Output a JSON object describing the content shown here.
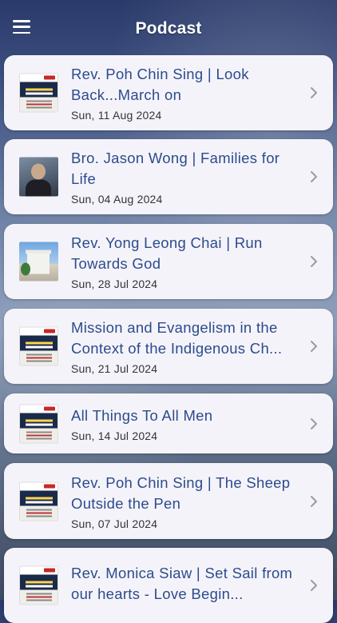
{
  "header": {
    "title": "Podcast",
    "menu_icon": "hamburger-menu-icon"
  },
  "colors": {
    "title_text": "#2b4c8c",
    "card_bg": "#f5f3fa",
    "date_text": "#333333",
    "chevron": "#9a9aa2"
  },
  "episodes": [
    {
      "title": "Rev. Poh Chin Sing | Look Back...March on",
      "date": "Sun, 11 Aug 2024",
      "thumbnail": "poster"
    },
    {
      "title": "Bro. Jason Wong | Families for Life",
      "date": "Sun, 04 Aug 2024",
      "thumbnail": "portrait"
    },
    {
      "title": "Rev. Yong Leong Chai | Run Towards God",
      "date": "Sun, 28 Jul 2024",
      "thumbnail": "building"
    },
    {
      "title": "Mission and Evangelism in the Context of the Indigenous Ch...",
      "date": "Sun, 21 Jul 2024",
      "thumbnail": "poster"
    },
    {
      "title": "All Things To All Men",
      "date": "Sun, 14 Jul 2024",
      "thumbnail": "poster"
    },
    {
      "title": "Rev. Poh Chin Sing | The Sheep Outside the Pen",
      "date": "Sun, 07 Jul 2024",
      "thumbnail": "poster"
    },
    {
      "title": "Rev. Monica Siaw | Set Sail from our hearts - Love Begin...",
      "date": "",
      "thumbnail": "poster"
    }
  ]
}
